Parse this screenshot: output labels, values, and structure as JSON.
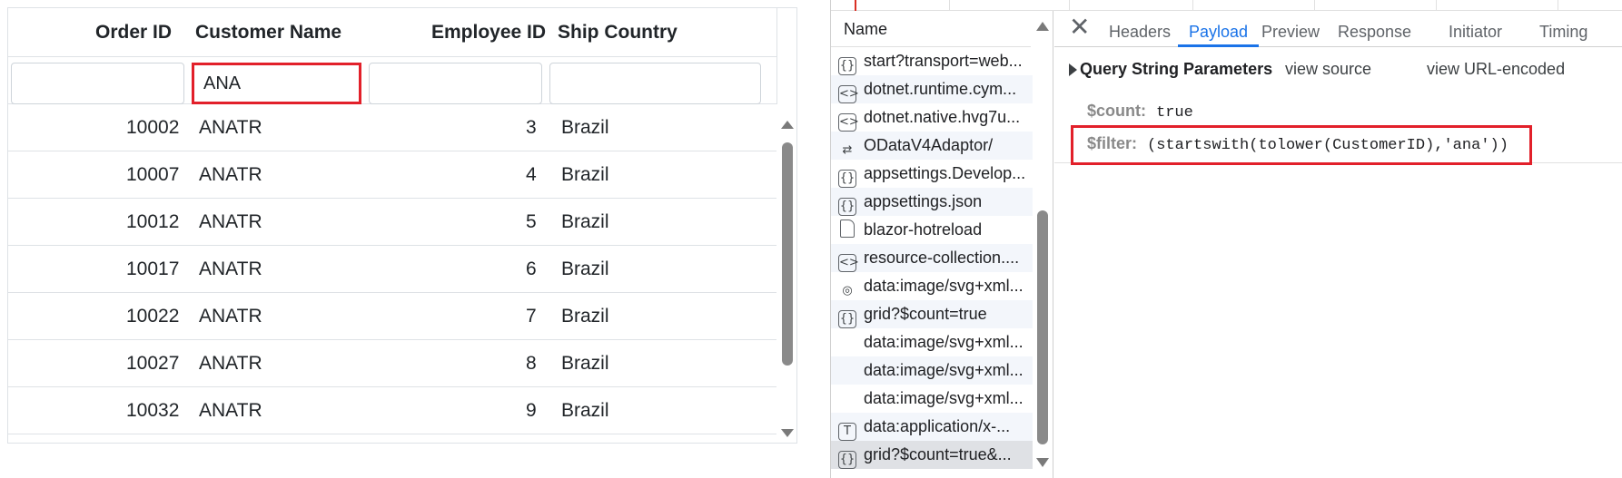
{
  "grid": {
    "columns": [
      "Order ID",
      "Customer Name",
      "Employee ID",
      "Ship Country"
    ],
    "filters": [
      "",
      "ANA",
      "",
      ""
    ],
    "rows": [
      {
        "order_id": "10002",
        "customer": "ANATR",
        "employee": "3",
        "country": "Brazil"
      },
      {
        "order_id": "10007",
        "customer": "ANATR",
        "employee": "4",
        "country": "Brazil"
      },
      {
        "order_id": "10012",
        "customer": "ANATR",
        "employee": "5",
        "country": "Brazil"
      },
      {
        "order_id": "10017",
        "customer": "ANATR",
        "employee": "6",
        "country": "Brazil"
      },
      {
        "order_id": "10022",
        "customer": "ANATR",
        "employee": "7",
        "country": "Brazil"
      },
      {
        "order_id": "10027",
        "customer": "ANATR",
        "employee": "8",
        "country": "Brazil"
      },
      {
        "order_id": "10032",
        "customer": "ANATR",
        "employee": "9",
        "country": "Brazil"
      }
    ]
  },
  "devtools": {
    "name_header": "Name",
    "requests": [
      {
        "label": "start?transport=web...",
        "icon": "{·}"
      },
      {
        "label": "dotnet.runtime.cym...",
        "icon": "<>"
      },
      {
        "label": "dotnet.native.hvg7u...",
        "icon": "<>"
      },
      {
        "label": "ODataV4Adaptor/",
        "icon": "⇄"
      },
      {
        "label": "appsettings.Develop...",
        "icon": "{·}"
      },
      {
        "label": "appsettings.json",
        "icon": "{·}"
      },
      {
        "label": "blazor-hotreload",
        "icon": "file"
      },
      {
        "label": "resource-collection....",
        "icon": "<>"
      },
      {
        "label": "data:image/svg+xml...",
        "icon": "◎"
      },
      {
        "label": "grid?$count=true",
        "icon": "{·}"
      },
      {
        "label": "data:image/svg+xml...",
        "icon": ""
      },
      {
        "label": "data:image/svg+xml...",
        "icon": ""
      },
      {
        "label": "data:image/svg+xml...",
        "icon": ""
      },
      {
        "label": "data:application/x-...",
        "icon": "T"
      },
      {
        "label": "grid?$count=true&...",
        "icon": "{·}"
      }
    ],
    "close_glyph": "✕",
    "tabs": [
      "Headers",
      "Payload",
      "Preview",
      "Response",
      "Initiator",
      "Timing"
    ],
    "active_tab": "Payload",
    "payload": {
      "section_title": "Query String Parameters",
      "view_source": "view source",
      "view_url_encoded": "view URL-encoded",
      "params": [
        {
          "key": "$count:",
          "value": "true"
        },
        {
          "key": "$filter:",
          "value": "(startswith(tolower(CustomerID),'ana'))"
        }
      ]
    }
  },
  "colors": {
    "highlight_red": "#e2202a",
    "tab_active": "#1a73e8",
    "grid_border": "#dee2e6"
  }
}
